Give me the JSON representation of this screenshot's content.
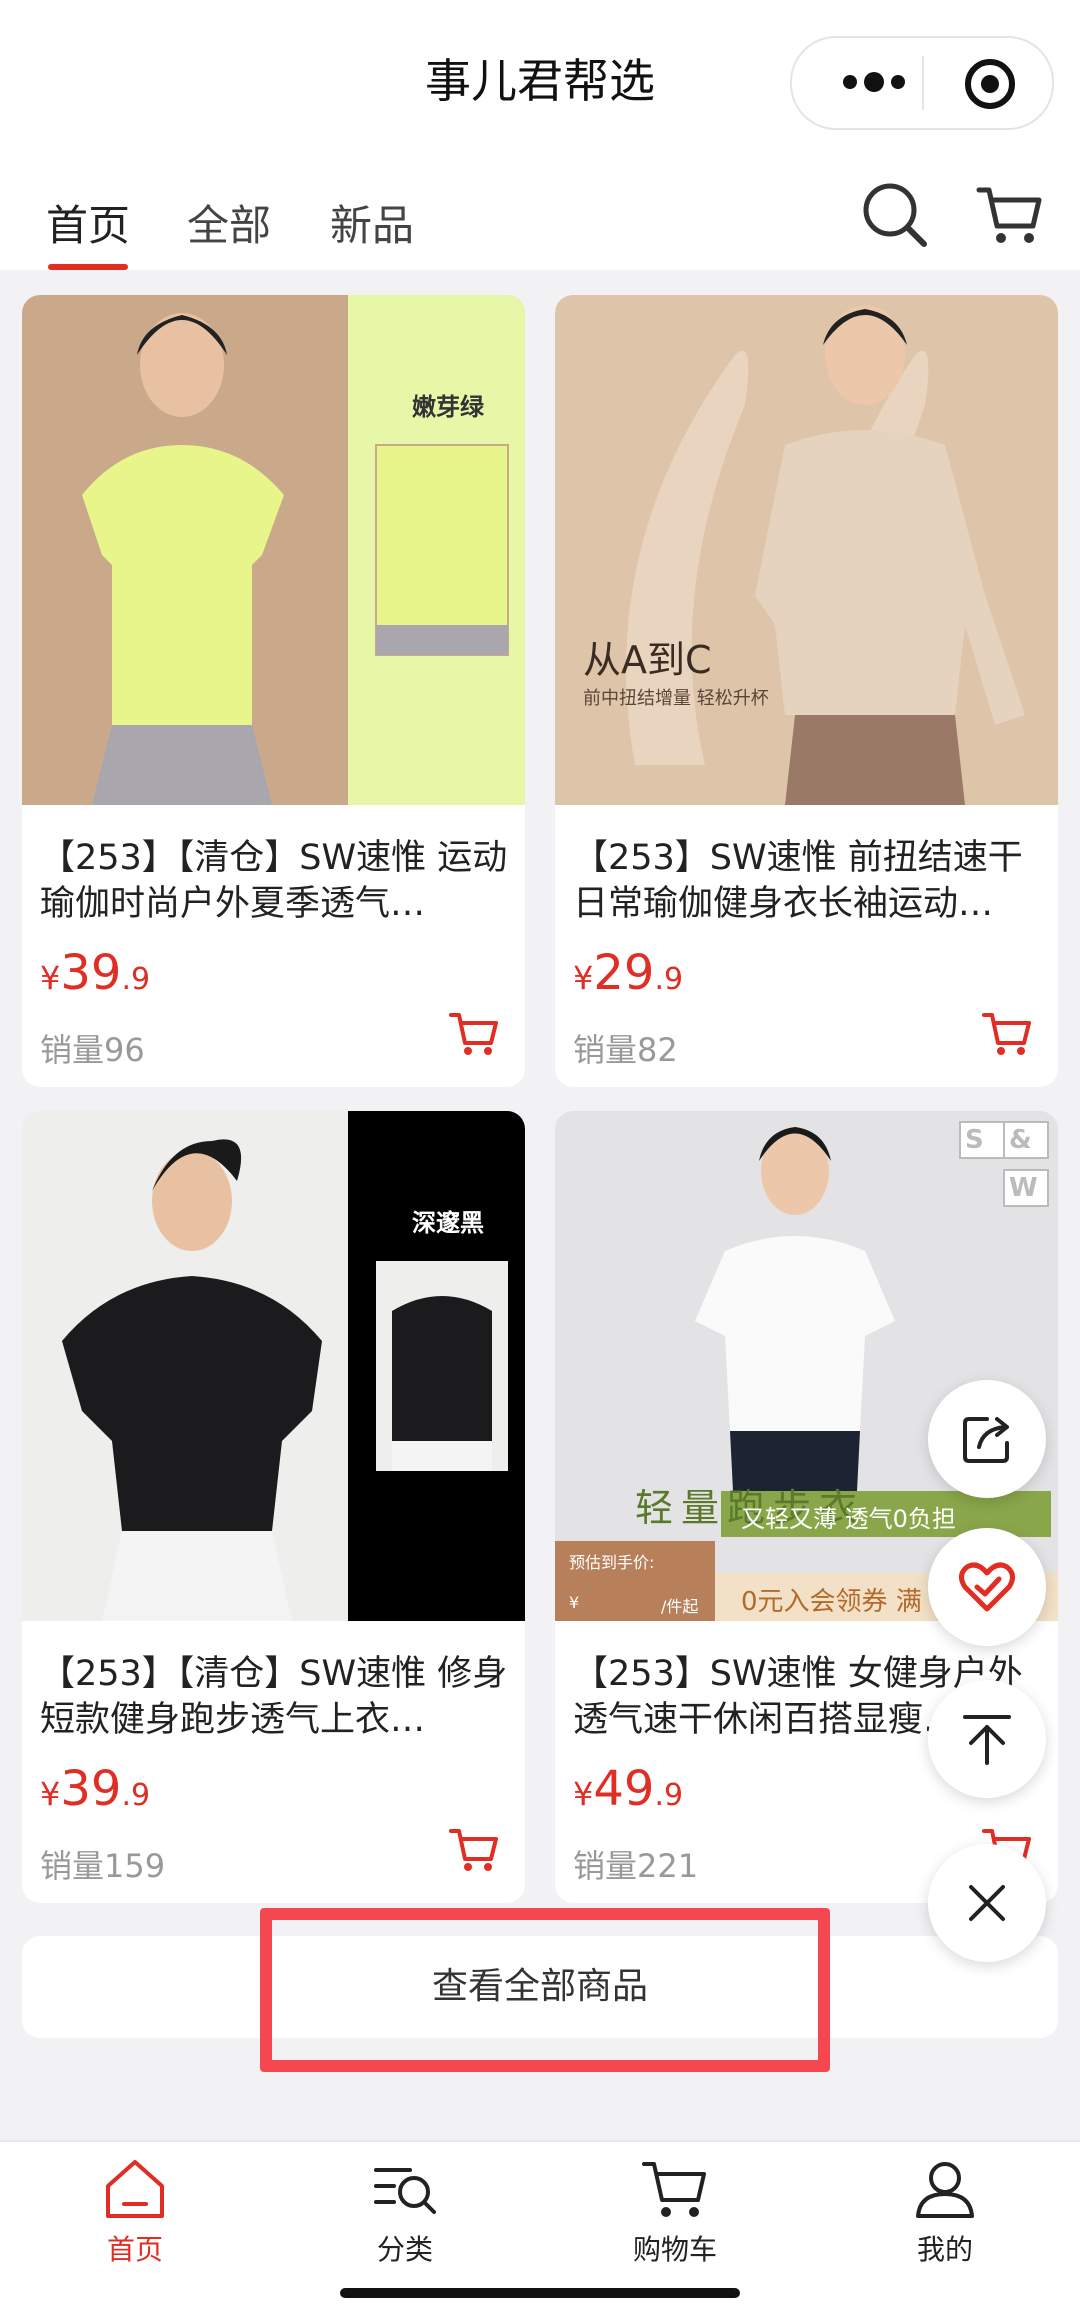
{
  "header": {
    "title": "事儿君帮选"
  },
  "tabs": [
    {
      "label": "首页",
      "active": true
    },
    {
      "label": "全部",
      "active": false
    },
    {
      "label": "新品",
      "active": false
    }
  ],
  "products": [
    {
      "title": "【253】【清仓】SW速惟 运动瑜伽时尚户外夏季透气…",
      "price_yen": "¥",
      "price_int": "39",
      "price_dec": ".9",
      "sales": "销量96",
      "image_tag": "嫩芽绿",
      "image_colors": {
        "bg": "#c9a98a",
        "shirt": "#e7f58a",
        "side": "#e6f7a8",
        "pants": "#a9a7ad"
      }
    },
    {
      "title": "【253】SW速惟 前扭结速干日常瑜伽健身衣长袖运动…",
      "price_yen": "¥",
      "price_int": "29",
      "price_dec": ".9",
      "sales": "销量82",
      "image_tag": "从A到C",
      "image_subtag": "前中扭结增量 轻松升杯",
      "image_colors": {
        "bg": "#dec4a8",
        "shirt": "#e6d3bf",
        "pants": "#9a7a66"
      }
    },
    {
      "title": "【253】【清仓】SW速惟 修身短款健身跑步透气上衣…",
      "price_yen": "¥",
      "price_int": "39",
      "price_dec": ".9",
      "sales": "销量159",
      "image_tag": "深邃黑",
      "image_colors": {
        "bg": "#eeeeec",
        "shirt": "#1b1b1d",
        "side": "#000000",
        "pants": "#f4f4f4"
      }
    },
    {
      "title": "【253】SW速惟 女健身户外透气速干休闲百搭显瘦…",
      "price_yen": "¥",
      "price_int": "49",
      "price_dec": ".9",
      "sales": "销量221",
      "image_tag": "轻量跑步衣",
      "image_subtag": "又轻又薄 透气0负担",
      "image_promo": "0元入会领券 满",
      "image_price_label": "预估到手价:",
      "image_price_unit": "¥",
      "image_price_suffix": "/件起",
      "image_logo": [
        "S",
        "&",
        "W"
      ],
      "image_colors": {
        "bg": "#e3e3e5",
        "shirt": "#fafafa",
        "pants": "#1c2333",
        "banner": "#8aa64a"
      }
    }
  ],
  "view_all_label": "查看全部商品",
  "bottom_nav": [
    {
      "label": "首页",
      "icon": "home-icon",
      "active": true
    },
    {
      "label": "分类",
      "icon": "category-icon",
      "active": false
    },
    {
      "label": "购物车",
      "icon": "cart-icon",
      "active": false
    },
    {
      "label": "我的",
      "icon": "user-icon",
      "active": false
    }
  ],
  "colors": {
    "accent": "#e02e24",
    "highlight_box": "#f5474f"
  }
}
